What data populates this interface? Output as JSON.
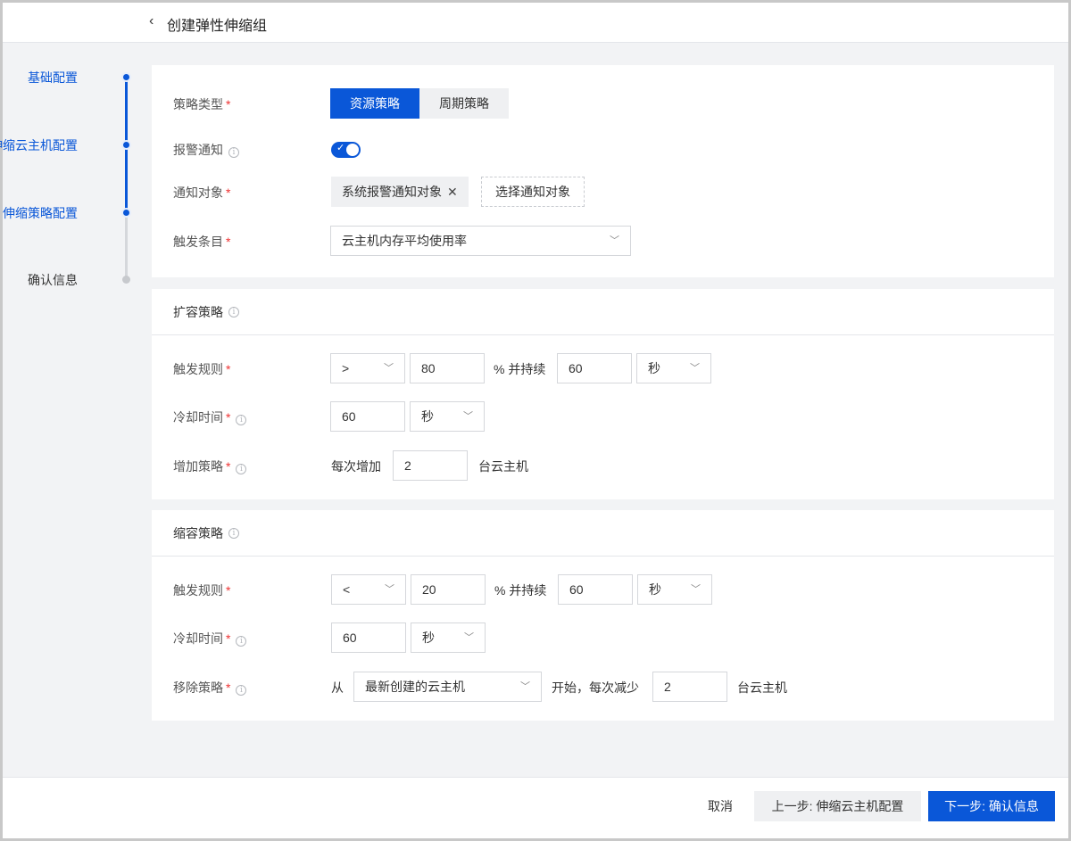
{
  "header": {
    "back_icon": "‹",
    "title": "创建弹性伸缩组"
  },
  "steps": [
    {
      "label": "基础配置",
      "state": "active"
    },
    {
      "label": "伸缩云主机配置",
      "state": "active"
    },
    {
      "label": "伸缩策略配置",
      "state": "active"
    },
    {
      "label": "确认信息",
      "state": "inactive"
    }
  ],
  "basic": {
    "policy_type_label": "策略类型",
    "policy_type_options": [
      "资源策略",
      "周期策略"
    ],
    "policy_type_selected": "资源策略",
    "alarm_notify_label": "报警通知",
    "alarm_notify_on": true,
    "notify_target_label": "通知对象",
    "notify_target_tag": "系统报警通知对象",
    "notify_target_button": "选择通知对象",
    "trigger_item_label": "触发条目",
    "trigger_item_value": "云主机内存平均使用率"
  },
  "scale_out": {
    "title": "扩容策略",
    "rule_label": "触发规则",
    "operator": ">",
    "threshold": "80",
    "percent_text": "% 并持续",
    "duration": "60",
    "duration_unit": "秒",
    "cooldown_label": "冷却时间",
    "cooldown_value": "60",
    "cooldown_unit": "秒",
    "add_label": "增加策略",
    "add_prefix": "每次增加",
    "add_value": "2",
    "add_suffix": "台云主机"
  },
  "scale_in": {
    "title": "缩容策略",
    "rule_label": "触发规则",
    "operator": "<",
    "threshold": "20",
    "percent_text": "% 并持续",
    "duration": "60",
    "duration_unit": "秒",
    "cooldown_label": "冷却时间",
    "cooldown_value": "60",
    "cooldown_unit": "秒",
    "remove_label": "移除策略",
    "remove_from": "从",
    "remove_select": "最新创建的云主机",
    "remove_middle": "开始，每次减少",
    "remove_value": "2",
    "remove_suffix": "台云主机"
  },
  "footer": {
    "cancel": "取消",
    "prev": "上一步: 伸缩云主机配置",
    "next": "下一步: 确认信息"
  },
  "required_mark": "*",
  "info_icon": "i",
  "chevron": "﹀",
  "colors": {
    "primary": "#0a57d8",
    "required": "#e33333",
    "background": "#f2f3f5"
  }
}
